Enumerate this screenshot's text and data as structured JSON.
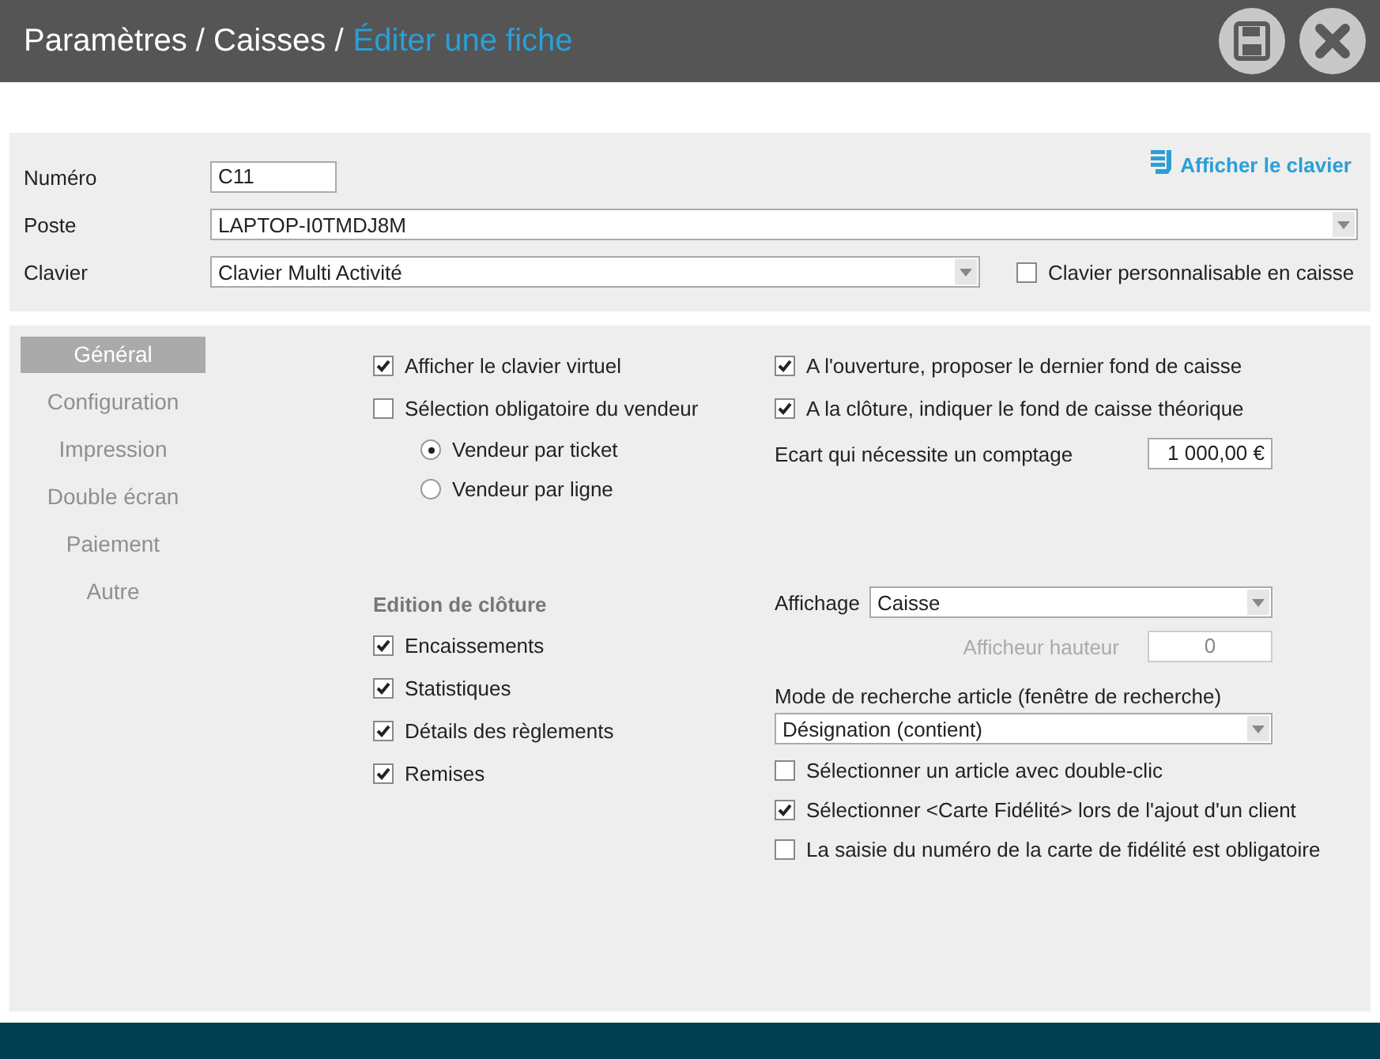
{
  "header": {
    "path": "Paramètres / Caisses /",
    "current": "Éditer une fiche"
  },
  "top_form": {
    "keyboard_link": "Afficher le clavier",
    "rows": [
      {
        "kind": "field",
        "label": "Numéro",
        "value": "C11"
      },
      {
        "kind": "select",
        "label": "Poste",
        "value": "LAPTOP-I0TMDJ8M"
      },
      {
        "kind": "select",
        "label": "Clavier",
        "value": "Clavier Multi Activité",
        "option": {
          "label": "Clavier personnalisable en caisse",
          "checked": false
        }
      }
    ]
  },
  "sidebar": {
    "items": [
      {
        "label": "Général",
        "selected": true
      },
      {
        "label": "Configuration",
        "selected": false
      },
      {
        "label": "Impression",
        "selected": false
      },
      {
        "label": "Double écran",
        "selected": false
      },
      {
        "label": "Paiement",
        "selected": false
      },
      {
        "label": "Autre",
        "selected": false
      }
    ]
  },
  "general": {
    "left_top": [
      {
        "kind": "checkbox",
        "label": "Afficher le clavier virtuel",
        "checked": true
      },
      {
        "kind": "checkbox",
        "label": "Sélection obligatoire du vendeur",
        "checked": false
      },
      {
        "kind": "radio",
        "label": "Vendeur par ticket",
        "selected": true
      },
      {
        "kind": "radio",
        "label": "Vendeur par ligne",
        "selected": false
      }
    ],
    "closing": {
      "heading": "Edition de clôture",
      "items": [
        {
          "kind": "checkbox",
          "label": "Encaissements",
          "checked": true
        },
        {
          "kind": "checkbox",
          "label": "Statistiques",
          "checked": true
        },
        {
          "kind": "checkbox",
          "label": "Détails des règlements",
          "checked": true
        },
        {
          "kind": "checkbox",
          "label": "Remises",
          "checked": true
        }
      ]
    },
    "right_top": [
      {
        "kind": "checkbox",
        "label": "A l'ouverture, proposer le dernier fond de caisse",
        "checked": true
      },
      {
        "kind": "checkbox",
        "label": "A  la clôture, indiquer le fond de caisse théorique",
        "checked": true
      },
      {
        "kind": "field",
        "label": "Ecart qui nécessite un comptage",
        "value": "1 000,00 €",
        "disabled": false
      }
    ],
    "right_bottom": [
      {
        "kind": "select",
        "label": "Affichage",
        "value": "Caisse"
      },
      {
        "kind": "field",
        "label": "Afficheur hauteur",
        "value": "0",
        "disabled": true
      },
      {
        "kind": "stacked-select",
        "label": "Mode de recherche article (fenêtre de recherche)",
        "value": "Désignation (contient)"
      },
      {
        "kind": "checkbox",
        "label": "Sélectionner un article avec double-clic",
        "checked": false
      },
      {
        "kind": "checkbox",
        "label": "Sélectionner <Carte Fidélité> lors de l'ajout d'un client",
        "checked": true
      },
      {
        "kind": "checkbox",
        "label": "La saisie du numéro de la carte de fidélité est obligatoire",
        "checked": false
      }
    ]
  }
}
